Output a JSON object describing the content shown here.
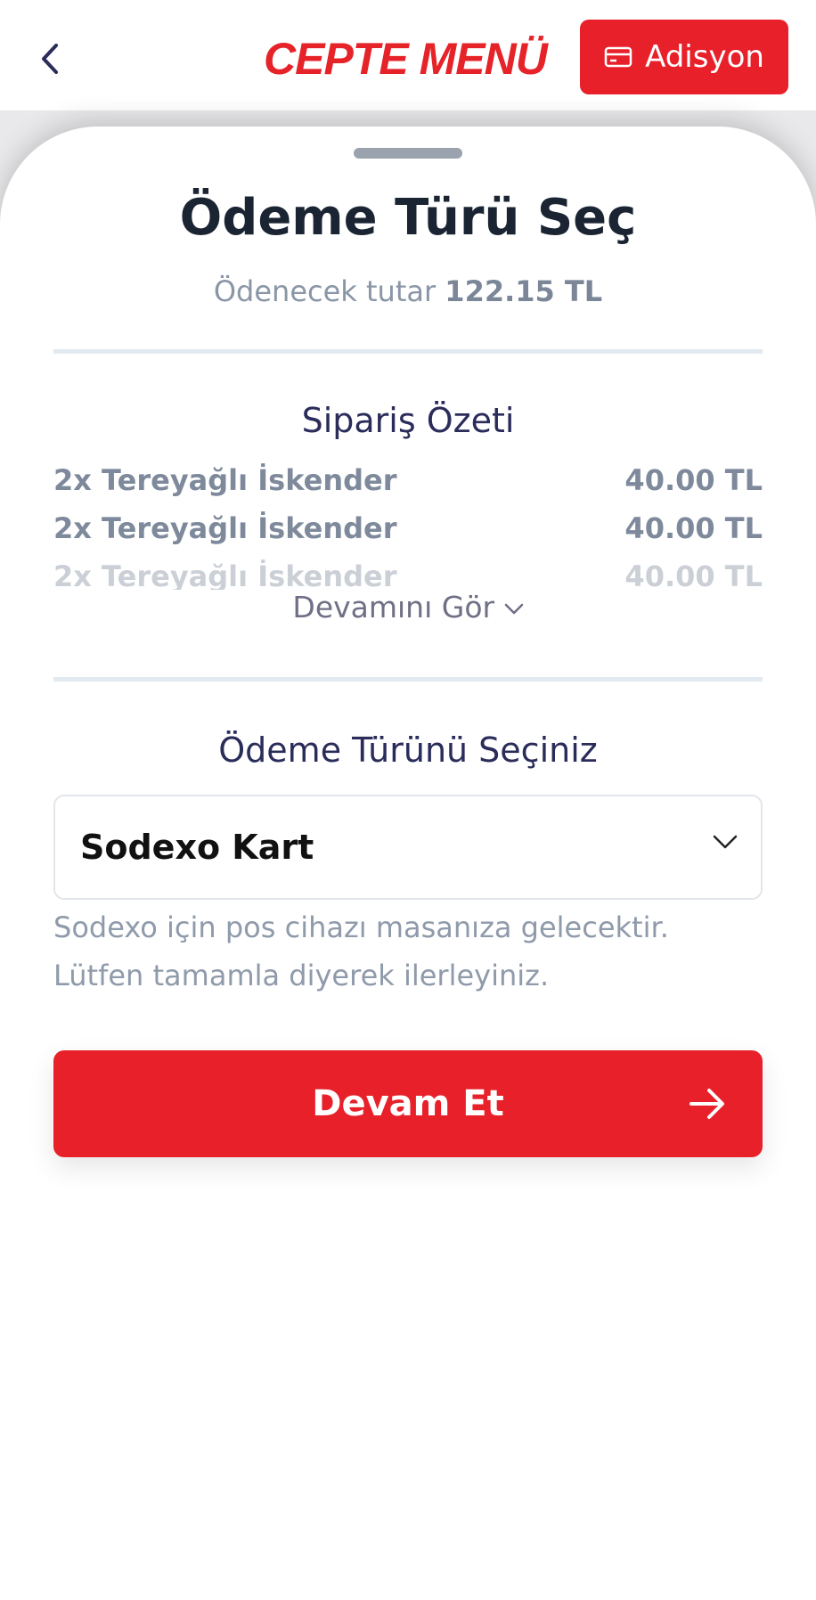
{
  "header": {
    "brand": "CEPTE MENÜ",
    "adisyon_label": "Adisyon"
  },
  "sheet": {
    "title": "Ödeme Türü Seç",
    "amount_label": "Ödenecek tutar",
    "amount_value": "122.15 TL"
  },
  "summary": {
    "title": "Sipariş Özeti",
    "items": [
      {
        "name": "2x Tereyağlı İskender",
        "price": "40.00 TL"
      },
      {
        "name": "2x Tereyağlı İskender",
        "price": "40.00 TL"
      },
      {
        "name": "2x Tereyağlı İskender",
        "price": "40.00 TL"
      }
    ],
    "see_more": "Devamını Gör"
  },
  "payment": {
    "title": "Ödeme Türünü Seçiniz",
    "selected": "Sodexo Kart",
    "info_line1": "Sodexo için pos cihazı masanıza gelecektir.",
    "info_line2": "Lütfen tamamla diyerek ilerleyiniz."
  },
  "actions": {
    "continue_label": "Devam Et"
  },
  "colors": {
    "brand_red": "#e8202a",
    "title_dark": "#1b2433",
    "muted": "#8a96a6"
  }
}
